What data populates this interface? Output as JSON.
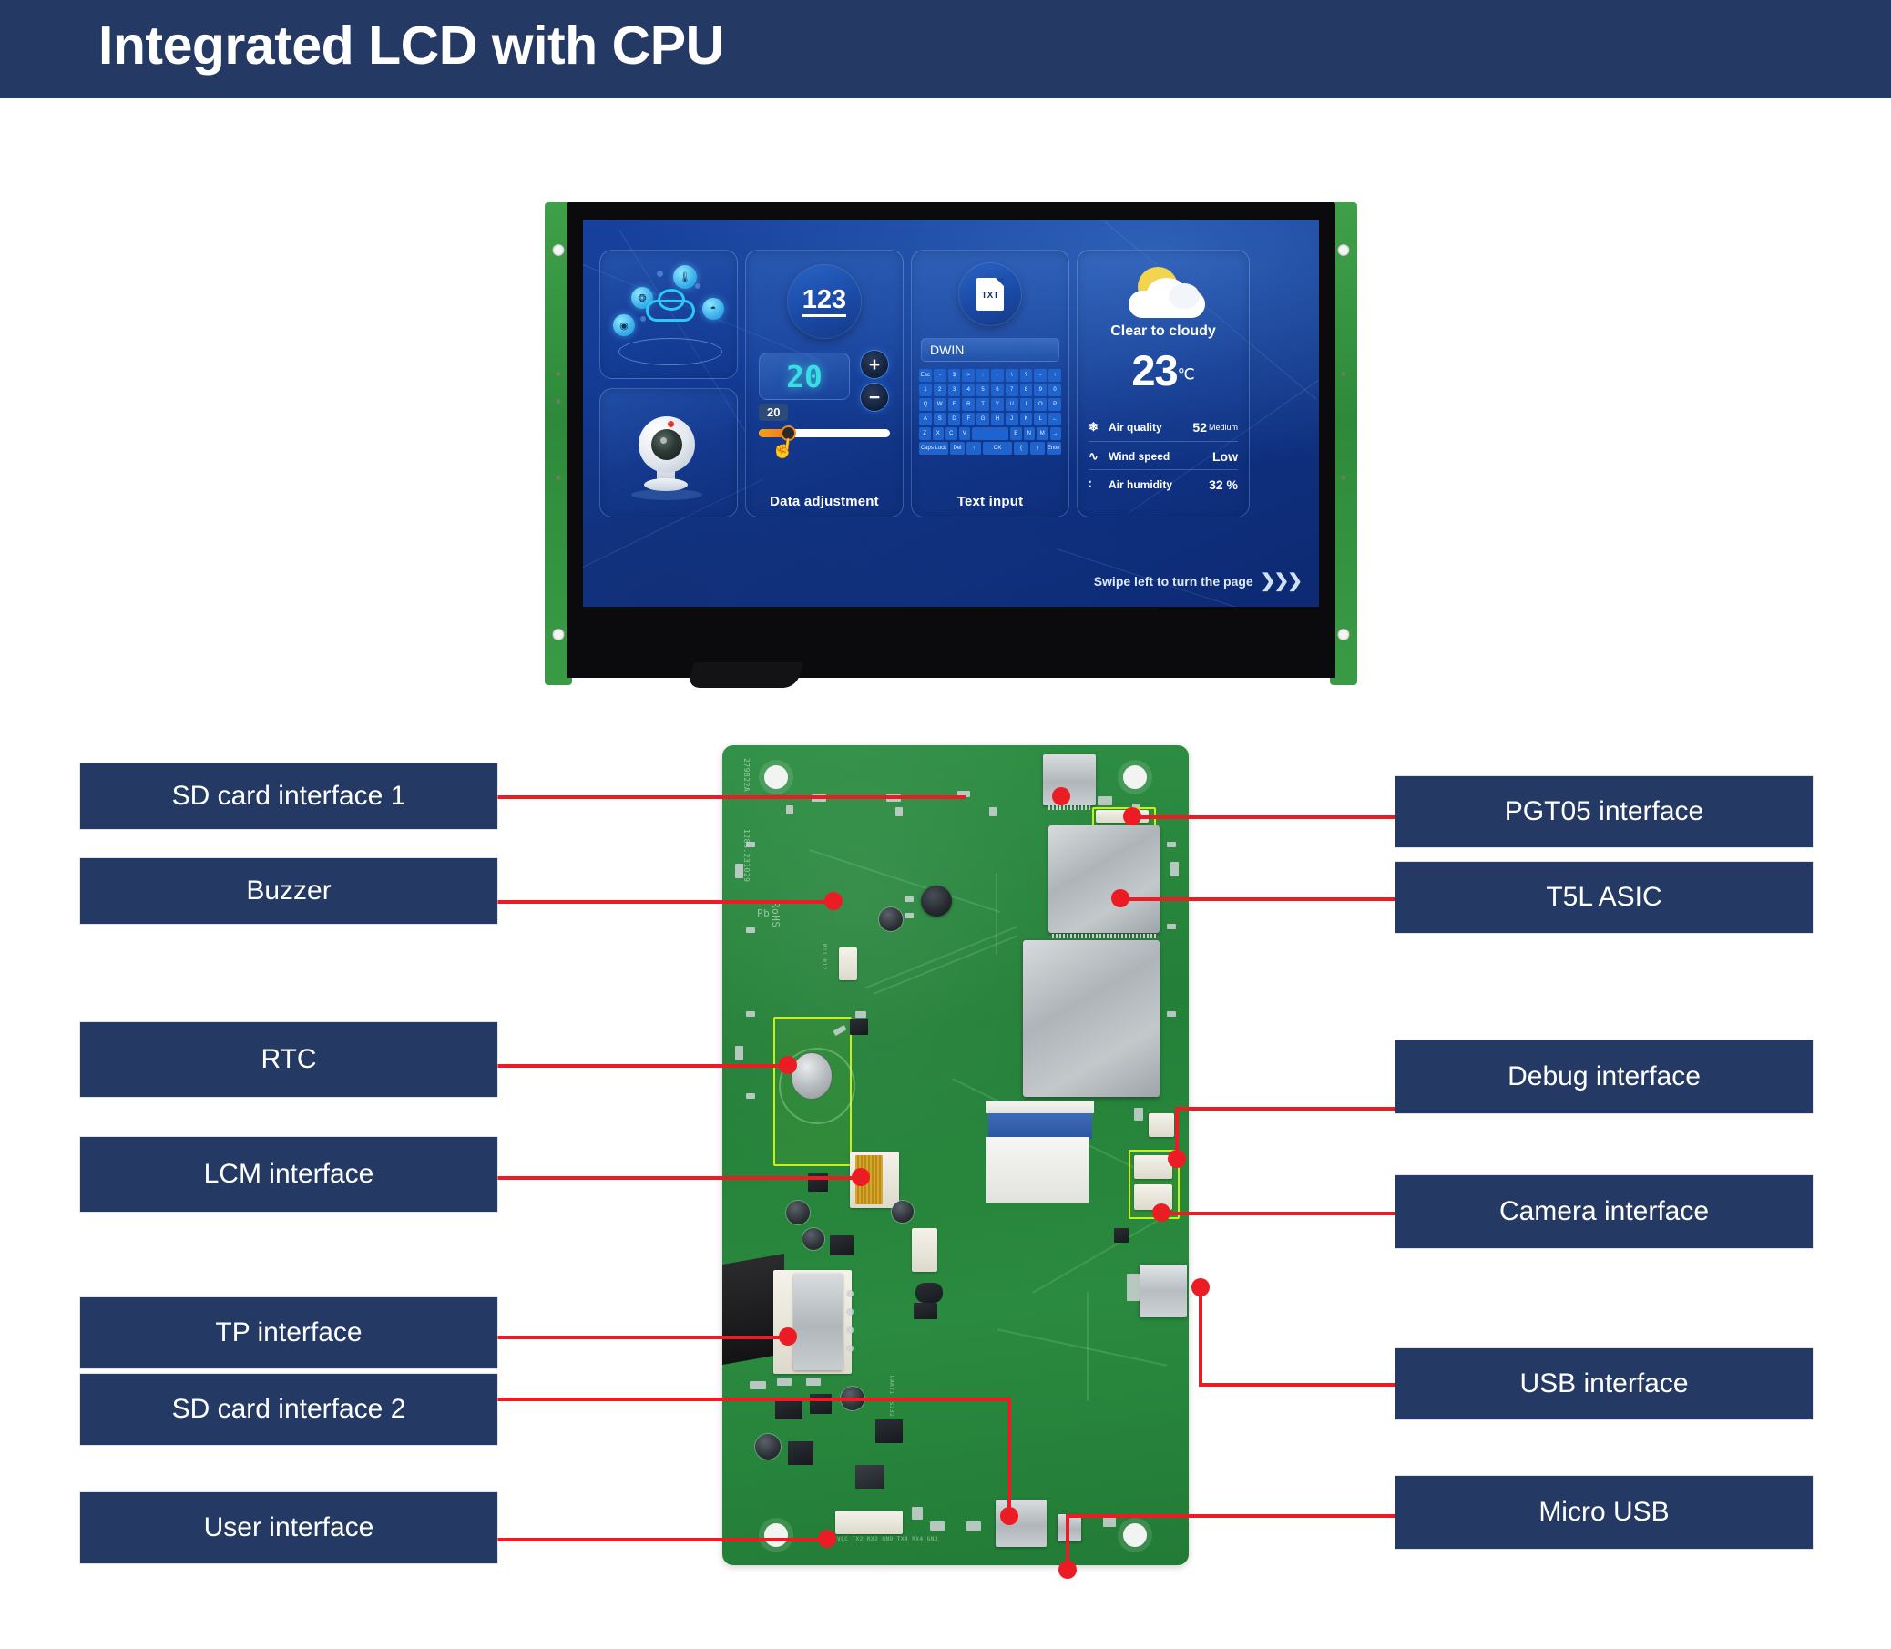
{
  "header": {
    "title": "Integrated LCD with CPU"
  },
  "lcd": {
    "panels": {
      "cloud": {
        "nodes": [
          "thermometer-icon",
          "fan-icon",
          "wifi-icon",
          "globe-icon"
        ]
      },
      "camera": {},
      "data_adjustment": {
        "circle_value": "123",
        "display_value": "20",
        "plus_label": "+",
        "minus_label": "−",
        "slider_value": "20",
        "caption": "Data adjustment"
      },
      "text_input": {
        "doc_label": "TXT",
        "field_value": "DWIN",
        "caption": "Text input",
        "keyboard_rows": [
          [
            "Esc",
            "~",
            "$",
            ">",
            ":",
            "·",
            "\\",
            "?",
            "−",
            "+"
          ],
          [
            "1",
            "2",
            "3",
            "4",
            "5",
            "6",
            "7",
            "8",
            "9",
            "0"
          ],
          [
            "Q",
            "W",
            "E",
            "R",
            "T",
            "Y",
            "U",
            "I",
            "O",
            "P"
          ],
          [
            "A",
            "S",
            "D",
            "F",
            "G",
            "H",
            "J",
            "K",
            "L",
            "←"
          ],
          [
            "Z",
            "X",
            "C",
            "V",
            "",
            "B",
            "N",
            "M",
            "→"
          ],
          [
            "Caps Lock",
            "Del",
            "↑",
            "OK",
            "{",
            "}",
            "Enter"
          ]
        ]
      },
      "weather": {
        "condition": "Clear to cloudy",
        "temperature": "23",
        "temperature_unit": "℃",
        "metrics": [
          {
            "icon": "leaf-icon",
            "label": "Air quality",
            "value": "52",
            "sub": "Medium"
          },
          {
            "icon": "wind-icon",
            "label": "Wind speed",
            "value": "Low",
            "sub": ""
          },
          {
            "icon": "humidity-icon",
            "label": "Air humidity",
            "value": "32 %",
            "sub": ""
          }
        ]
      }
    },
    "swipe_hint": "Swipe left to turn the page",
    "swipe_chevrons": "❯❯❯"
  },
  "pcb": {
    "silkscreen": {
      "serial": "279822A",
      "code": "1286.231029",
      "rohs": "RoHS",
      "pb": "Pb",
      "uart_pins": "VCC TX2 RX2 GND TX4 RX4 GND"
    }
  },
  "callouts": {
    "left": [
      {
        "label": "SD card interface 1"
      },
      {
        "label": "Buzzer"
      },
      {
        "label": "RTC"
      },
      {
        "label": "LCM interface"
      },
      {
        "label": "TP interface"
      },
      {
        "label": "SD card interface 2"
      },
      {
        "label": "User interface"
      }
    ],
    "right": [
      {
        "label": "PGT05 interface"
      },
      {
        "label": "T5L ASIC"
      },
      {
        "label": "Debug interface"
      },
      {
        "label": "Camera interface"
      },
      {
        "label": "USB interface"
      },
      {
        "label": "Micro USB"
      }
    ]
  },
  "colors": {
    "navy": "#243963",
    "red": "#ec1c24",
    "pcb_green": "#2a8a3f",
    "highlight_yellow": "#c6f018"
  }
}
